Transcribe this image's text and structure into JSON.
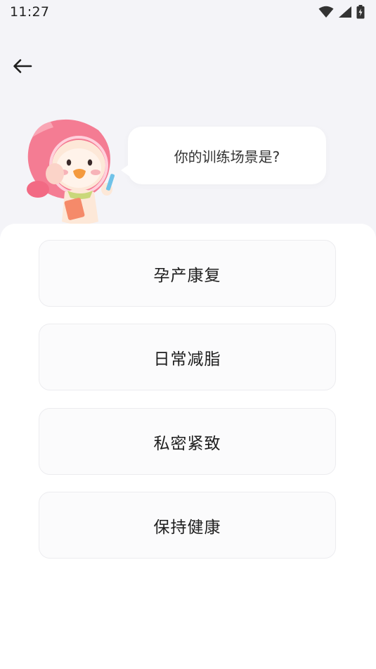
{
  "status_bar": {
    "time": "11:27",
    "icons": [
      "wifi-icon",
      "cellular-signal-icon",
      "battery-charging-icon"
    ]
  },
  "nav": {
    "back_icon": "arrow-left-icon"
  },
  "question": {
    "text": "你的训练场景是?"
  },
  "options": [
    {
      "label": "孕产康复"
    },
    {
      "label": "日常减脂"
    },
    {
      "label": "私密紧致"
    },
    {
      "label": "保持健康"
    }
  ],
  "colors": {
    "background": "#f4f4f8",
    "card": "#ffffff",
    "option_bg": "#fbfbfc",
    "mascot_pink": "#f47c93"
  }
}
